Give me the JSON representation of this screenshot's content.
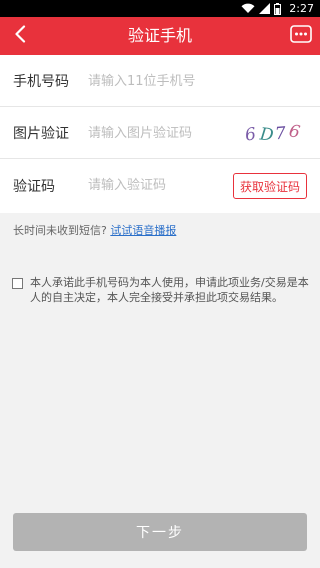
{
  "status_bar": {
    "time": "2:27"
  },
  "header": {
    "title": "验证手机"
  },
  "form": {
    "phone": {
      "label": "手机号码",
      "placeholder": "请输入11位手机号"
    },
    "image_code": {
      "label": "图片验证",
      "placeholder": "请输入图片验证码",
      "captcha_text": "6D76"
    },
    "sms_code": {
      "label": "验证码",
      "placeholder": "请输入验证码",
      "button_label": "获取验证码"
    }
  },
  "hint": {
    "text": "长时间未收到短信?",
    "link": "试试语音播报"
  },
  "agreement": {
    "text": "本人承诺此手机号码为本人使用，申请此项业务/交易是本人的自主决定，本人完全接受并承担此项交易结果。",
    "checked": false
  },
  "next_button": {
    "label": "下一步"
  },
  "colors": {
    "brand_red": "#e8323c",
    "link_blue": "#2a6fc9",
    "disabled_gray": "#b3b3b3"
  }
}
